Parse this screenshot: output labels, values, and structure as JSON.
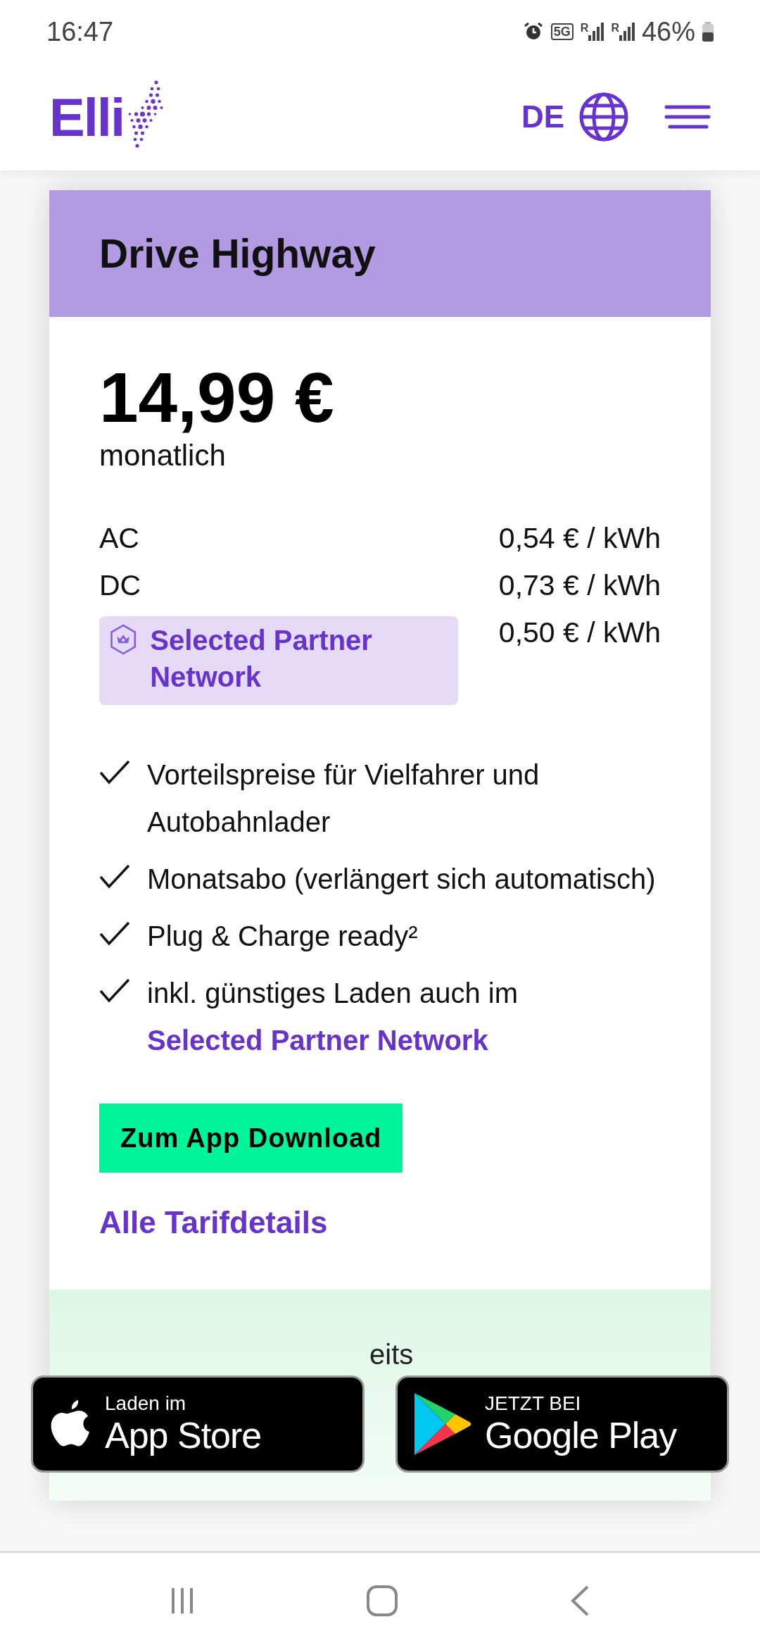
{
  "status_bar": {
    "time": "16:47",
    "network": "5G",
    "signals": [
      {
        "roaming": "R"
      },
      {
        "roaming": "R"
      }
    ],
    "battery": "46%"
  },
  "header": {
    "logo": "Elli",
    "language": "DE"
  },
  "tariff": {
    "title": "Drive Highway",
    "price": "14,99 €",
    "period": "monatlich",
    "rates": [
      {
        "kind": "plain",
        "label": "AC",
        "price": "0,54 € / kWh"
      },
      {
        "kind": "plain",
        "label": "DC",
        "price": "0,73 € / kWh"
      },
      {
        "kind": "badge",
        "label": "Selected Partner Network",
        "price": "0,50 € / kWh"
      }
    ],
    "features": [
      {
        "text": "Vorteilspreise für Vielfahrer und Autobahnlader"
      },
      {
        "text": "Monatsabo (verlängert sich automatisch)"
      },
      {
        "text": "Plug & Charge ready²"
      },
      {
        "text": "inkl. günstiges Laden auch im",
        "link": "Selected Partner Network"
      }
    ],
    "download_button": "Zum App Download",
    "details_link": "Alle Tarifdetails"
  },
  "next_panel": {
    "text_fragment": "eits"
  },
  "store_buttons": [
    {
      "kind": "apple",
      "small": "Laden im",
      "big": "App Store"
    },
    {
      "kind": "google",
      "small": "JETZT BEI",
      "big": "Google Play"
    }
  ]
}
